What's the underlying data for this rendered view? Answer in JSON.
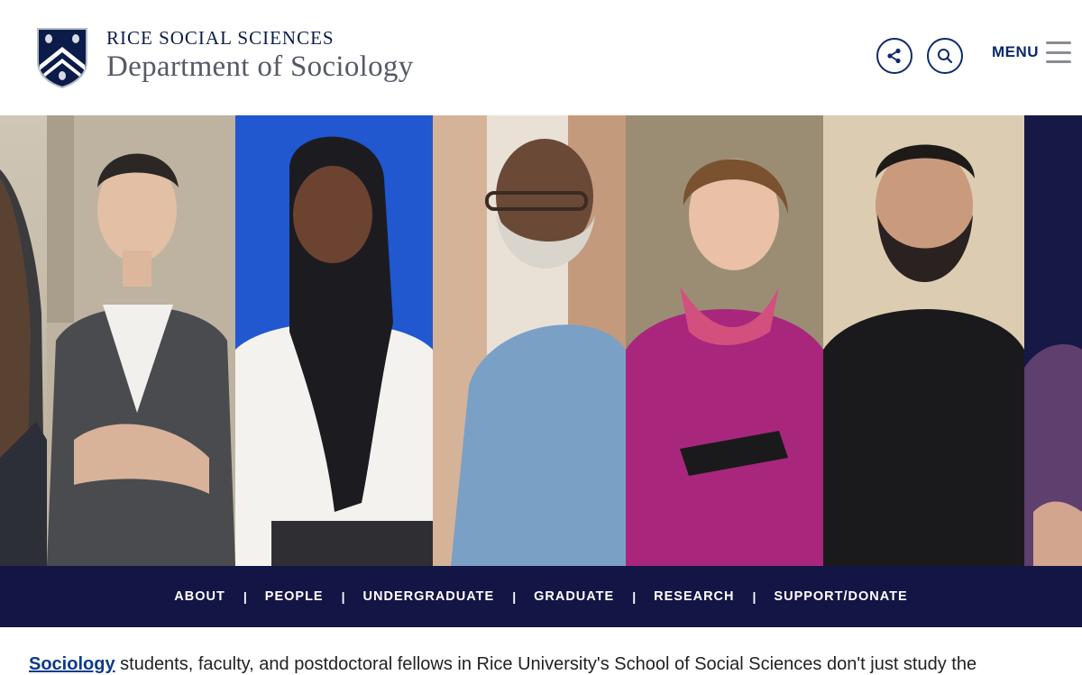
{
  "header": {
    "brand_top": "RICE SOCIAL SCIENCES",
    "brand_main": "Department of Sociology",
    "menu_label": "MENU"
  },
  "icons": {
    "logo": "rice-shield-icon",
    "share": "share-icon",
    "search": "search-icon",
    "menu": "hamburger-icon"
  },
  "nav": {
    "items": [
      "ABOUT",
      "PEOPLE",
      "UNDERGRADUATE",
      "GRADUATE",
      "RESEARCH",
      "SUPPORT/DONATE"
    ],
    "separator": "|"
  },
  "intro": {
    "link": "Sociology",
    "text": " students, faculty, and postdoctoral fellows in Rice University's School of Social Sciences don't just study the"
  },
  "colors": {
    "brand_navy": "#0b1c4a",
    "nav_bg": "#131545",
    "accent_blue": "#0b2a6b"
  }
}
